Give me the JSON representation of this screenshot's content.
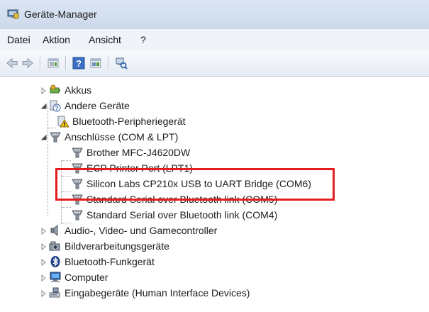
{
  "window": {
    "title": "Geräte-Manager"
  },
  "menu": {
    "items": [
      "Datei",
      "Aktion",
      "Ansicht",
      "?"
    ]
  },
  "toolbar": {
    "buttons": [
      "back-arrow-icon",
      "forward-arrow-icon",
      "properties-icon",
      "help-icon",
      "view-icon",
      "scan-hardware-icon"
    ]
  },
  "tree": {
    "nodes": [
      {
        "label": "Akkus",
        "icon": "battery-icon",
        "expander": "collapsed"
      },
      {
        "label": "Andere Geräte",
        "icon": "unknown-device-icon",
        "expander": "expanded"
      },
      {
        "label": "Bluetooth-Peripheriegerät",
        "icon": "warning-device-icon",
        "expander": "none"
      },
      {
        "label": "Anschlüsse (COM & LPT)",
        "icon": "port-icon",
        "expander": "expanded"
      },
      {
        "label": "Brother MFC-J4620DW",
        "icon": "port-icon",
        "expander": "none"
      },
      {
        "label": "ECP Printer Port (LPT1)",
        "icon": "port-icon",
        "expander": "none"
      },
      {
        "label": "Silicon Labs CP210x USB to UART Bridge (COM6)",
        "icon": "port-icon",
        "expander": "none"
      },
      {
        "label": "Standard Serial over Bluetooth link (COM5)",
        "icon": "port-icon",
        "expander": "none"
      },
      {
        "label": "Standard Serial over Bluetooth link (COM4)",
        "icon": "port-icon",
        "expander": "none"
      },
      {
        "label": "Audio-, Video- und Gamecontroller",
        "icon": "speaker-icon",
        "expander": "collapsed"
      },
      {
        "label": "Bildverarbeitungsgeräte",
        "icon": "camera-icon",
        "expander": "collapsed"
      },
      {
        "label": "Bluetooth-Funkgerät",
        "icon": "bluetooth-icon",
        "expander": "collapsed"
      },
      {
        "label": "Computer",
        "icon": "computer-icon",
        "expander": "collapsed"
      },
      {
        "label": "Eingabegeräte (Human Interface Devices)",
        "icon": "hid-icon",
        "expander": "collapsed"
      }
    ]
  },
  "colors": {
    "highlight": "#e31e1e",
    "titlebar": "#d6e1f0"
  }
}
